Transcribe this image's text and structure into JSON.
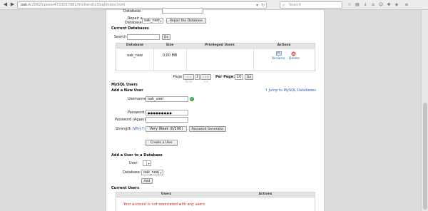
{
  "browser": {
    "url_host": "oak.n",
    "url_rest": "2082/cpsess4733057881/frontend/x3/sql/index.html",
    "search_placeholder": "Search"
  },
  "top_section": {
    "database_label": "Database:",
    "repair_label_line1": "Repair a",
    "repair_label_line2": "Database:",
    "repair_select_value": "oak_new",
    "repair_button": "Repair the Database"
  },
  "current_databases": {
    "title": "Current Databases",
    "search_label": "Search",
    "go_button": "Go",
    "columns": [
      "Database",
      "Size",
      "Privileged Users",
      "Actions"
    ],
    "rows": [
      {
        "database": "oak_new",
        "size": "0.00 MB",
        "privileged_users": ""
      }
    ],
    "rename_label": "Rename",
    "delete_label": "Delete",
    "page_label": "Page:",
    "first_label": "<< First",
    "page_value": "1",
    "last_label": "Last >>",
    "per_page_label": "Per Page:",
    "per_page_value": "10",
    "per_page_go": "Go"
  },
  "mysql_users": {
    "title": "MySQL Users",
    "jump_link": "Jump to MySQL Databases",
    "add_new_title": "Add a New User",
    "username_label": "Username:",
    "username_value": "oak_user",
    "password_label": "Password:",
    "password_value": "●●●●●●●●●",
    "password_again_label": "Password (Again):",
    "strength_label": "Strength",
    "why_label": "(Why?)",
    "strength_value": "Very Weak (0/100)",
    "password_generator_button": "Password Generator",
    "create_button": "Create a User"
  },
  "add_user_to_db": {
    "title": "Add a User to a Database",
    "user_label": "User:",
    "user_value": "",
    "database_label": "Database:",
    "database_value": "oak_new",
    "add_button": "Add"
  },
  "current_users": {
    "title": "Current Users",
    "columns": [
      "Users",
      "Actions"
    ],
    "message": "Your account is not associated with any users."
  }
}
